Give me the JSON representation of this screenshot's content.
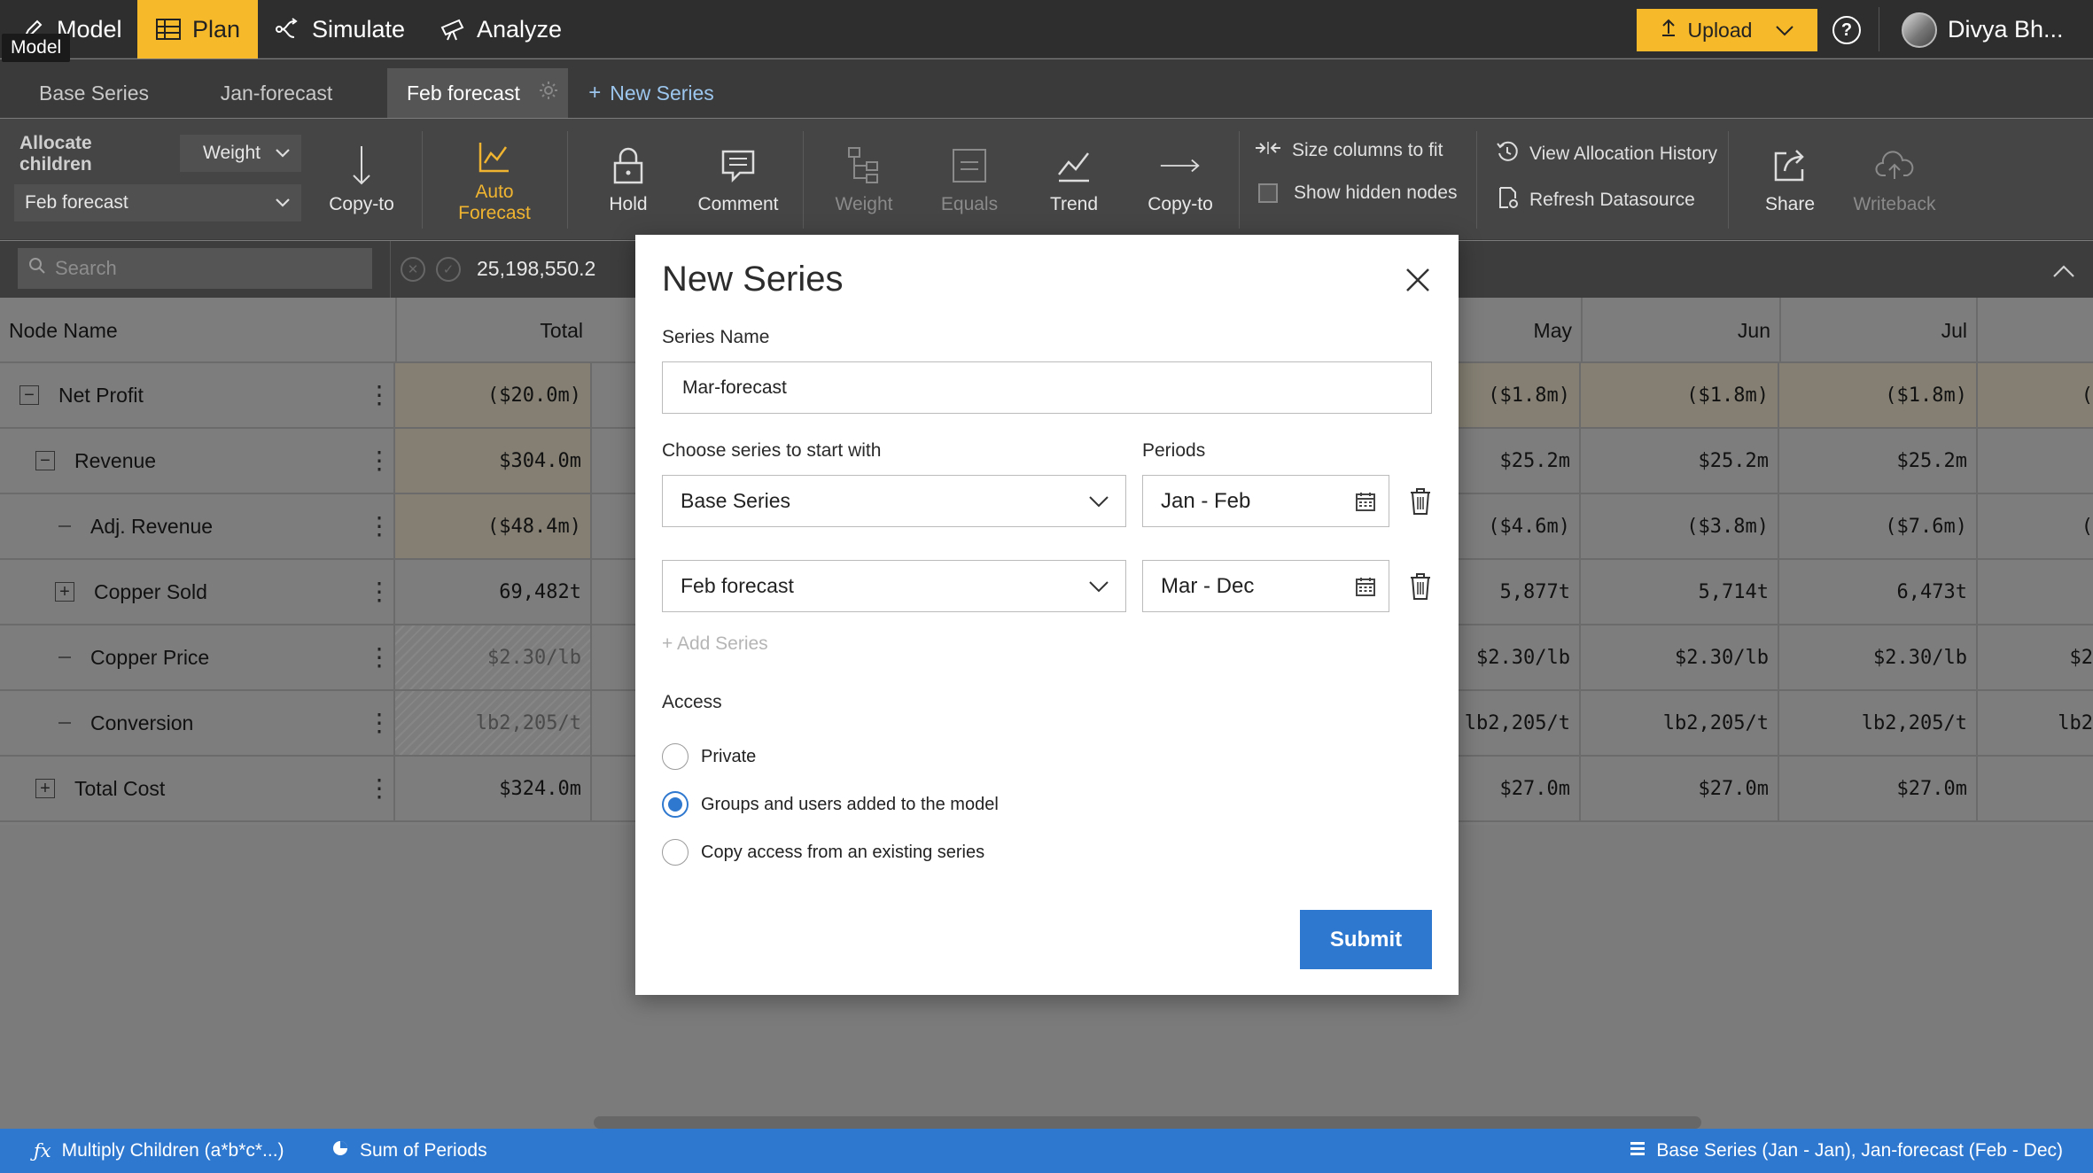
{
  "nav": {
    "tabs": [
      {
        "label": "Model",
        "icon": "pencil-icon"
      },
      {
        "label": "Plan",
        "icon": "grid-icon",
        "active": true
      },
      {
        "label": "Simulate",
        "icon": "branch-icon"
      },
      {
        "label": "Analyze",
        "icon": "telescope-icon"
      }
    ],
    "tooltip": "Model",
    "upload_label": "Upload",
    "help_label": "?",
    "user_name": "Divya Bh..."
  },
  "series_tabs": {
    "items": [
      "Base Series",
      "Jan-forecast",
      "Feb forecast"
    ],
    "active_index": 2,
    "new_label": "New Series"
  },
  "toolbar": {
    "allocate_label": "Allocate children",
    "weight_select": "Weight",
    "series_select": "Feb forecast",
    "copy_to_1": "Copy-to",
    "auto_forecast": "Auto Forecast",
    "hold": "Hold",
    "comment": "Comment",
    "weight": "Weight",
    "equals": "Equals",
    "trend": "Trend",
    "copy_to_2": "Copy-to",
    "size_columns": "Size columns to fit",
    "show_hidden": "Show hidden nodes",
    "view_allocation_history": "View Allocation History",
    "refresh_datasource": "Refresh Datasource",
    "share": "Share",
    "writeback": "Writeback"
  },
  "search": {
    "placeholder": "Search",
    "value_display": "25,198,550.2"
  },
  "grid": {
    "headers": {
      "node": "Node Name",
      "total": "Total",
      "may": "May",
      "jun": "Jun",
      "jul": "Jul"
    },
    "rows": [
      {
        "name": "Net Profit",
        "toggle": "minus",
        "total": "($20.0m)",
        "may": "($1.8m)",
        "jun": "($1.8m)",
        "jul": "($1.8m)",
        "edge": "("
      },
      {
        "name": "Revenue",
        "toggle": "minus",
        "total": "$304.0m",
        "may": "$25.2m",
        "jun": "$25.2m",
        "jul": "$25.2m",
        "edge": ""
      },
      {
        "name": "Adj. Revenue",
        "toggle": "dash",
        "total": "($48.4m)",
        "may": "($4.6m)",
        "jun": "($3.8m)",
        "jul": "($7.6m)",
        "edge": "("
      },
      {
        "name": "Copper Sold",
        "toggle": "plus",
        "total": "69,482t",
        "may": "5,877t",
        "jun": "5,714t",
        "jul": "6,473t",
        "edge": ""
      },
      {
        "name": "Copper Price",
        "toggle": "dash",
        "total": "$2.30/lb",
        "may": "$2.30/lb",
        "jun": "$2.30/lb",
        "jul": "$2.30/lb",
        "edge": "$2"
      },
      {
        "name": "Conversion",
        "toggle": "dash",
        "total": "lb2,205/t",
        "may": "lb2,205/t",
        "jun": "lb2,205/t",
        "jul": "lb2,205/t",
        "edge": "lb2"
      },
      {
        "name": "Total Cost",
        "toggle": "plus",
        "total": "$324.0m",
        "may": "$27.0m",
        "jun": "$27.0m",
        "jul": "$27.0m",
        "edge": ""
      }
    ]
  },
  "modal": {
    "title": "New Series",
    "series_name_label": "Series Name",
    "series_name_value": "Mar-forecast",
    "choose_label": "Choose series to start with",
    "periods_label": "Periods",
    "series_rows": [
      {
        "series": "Base Series",
        "period": "Jan - Feb"
      },
      {
        "series": "Feb forecast",
        "period": "Mar - Dec"
      }
    ],
    "add_series": "+ Add Series",
    "access_label": "Access",
    "access_options": [
      {
        "label": "Private",
        "selected": false
      },
      {
        "label": "Groups and users added to the model",
        "selected": true
      },
      {
        "label": "Copy access from an existing series",
        "selected": false
      }
    ],
    "submit_label": "Submit"
  },
  "status": {
    "formula": "Multiply Children (a*b*c*...)",
    "aggregation": "Sum of Periods",
    "series_info": "Base Series (Jan - Jan), Jan-forecast (Feb - Dec)"
  },
  "colors": {
    "accent": "#f6b92a",
    "primary_blue": "#2f78cf"
  }
}
